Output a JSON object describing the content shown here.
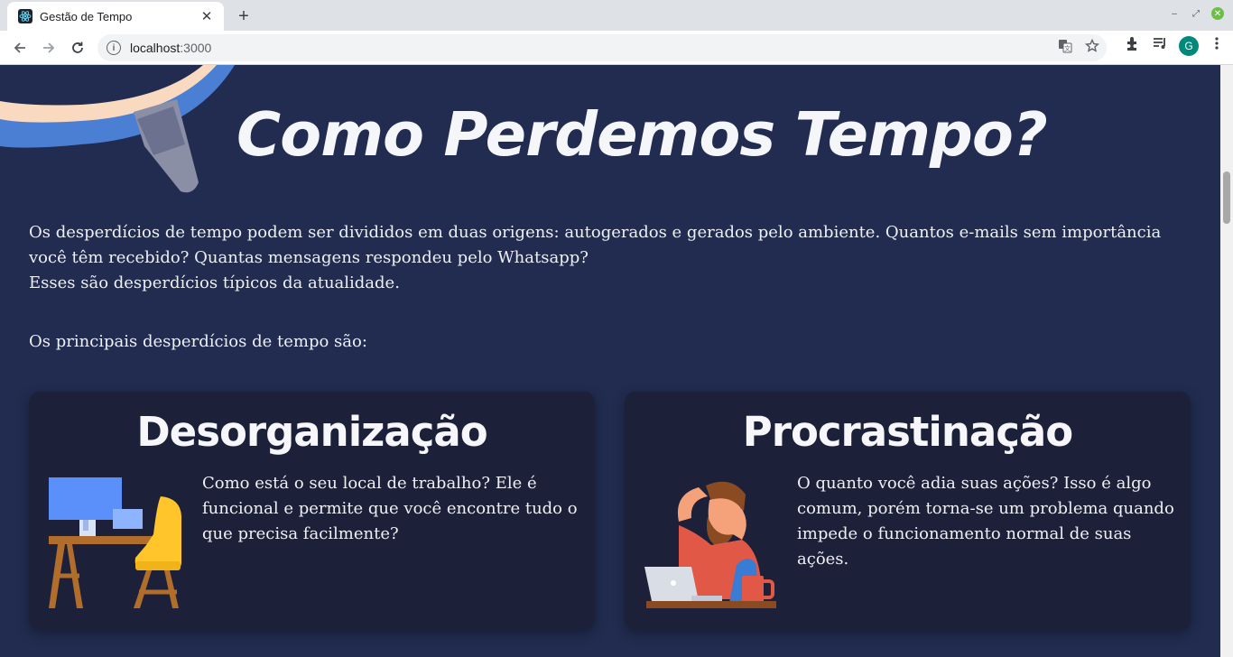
{
  "browser": {
    "tab_title": "Gestão de Tempo",
    "url_host": "localhost",
    "url_port": ":3000",
    "avatar_letter": "G",
    "icons": [
      "react-favicon-icon",
      "close-icon",
      "plus-icon",
      "back-icon",
      "forward-icon",
      "reload-icon",
      "info-icon",
      "translate-icon",
      "star-icon",
      "extensions-icon",
      "media-icon",
      "menu-icon"
    ]
  },
  "page": {
    "title": "Como Perdemos Tempo?",
    "intro_line1": "Os desperdícios de tempo podem ser divididos em duas origens: autogerados e gerados pelo ambiente. Quantos e-mails sem importância você têm recebido? Quantas mensagens respondeu pelo Whatsapp?",
    "intro_line2": "Esses são desperdícios típicos da atualidade.",
    "lead": "Os principais desperdícios de tempo são:",
    "cards": [
      {
        "title": "Desorganização",
        "text": "Como está o seu local de trabalho? Ele é funcional e permite que você encontre tudo o que precisa facilmente?",
        "illustration": "desk-workspace-illustration"
      },
      {
        "title": "Procrastinação",
        "text": "O quanto você adia suas ações? Isso é algo comum, porém torna-se um problema quando impede o funcionamento normal de suas ações.",
        "illustration": "stressed-man-laptop-illustration"
      }
    ]
  },
  "colors": {
    "page_bg": "#212c50",
    "card_bg": "#1c2139",
    "text": "#eef0f6",
    "accent_blue": "#4a7fd4",
    "accent_peach": "#f9d9c0"
  }
}
